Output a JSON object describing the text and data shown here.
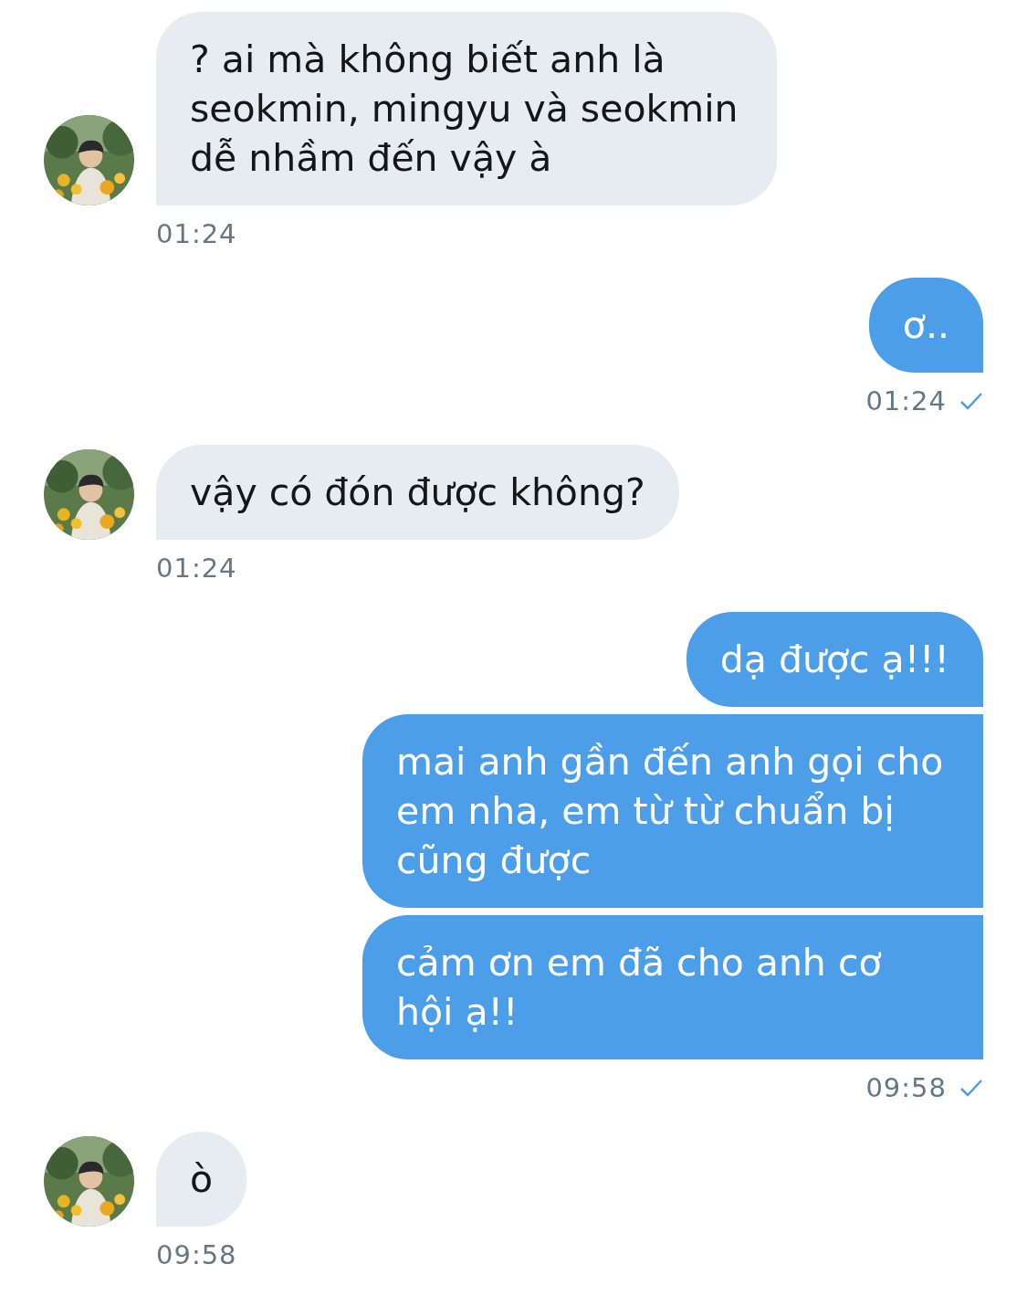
{
  "messages": [
    {
      "kind": "incoming",
      "bubbles": [
        "? ai mà không biết anh là seokmin, mingyu và seokmin dễ nhầm đến vậy à"
      ],
      "time": "01:24"
    },
    {
      "kind": "outgoing",
      "bubbles": [
        "ơ.."
      ],
      "time": "01:24",
      "delivered": true
    },
    {
      "kind": "incoming",
      "bubbles": [
        "vậy có đón được không?"
      ],
      "time": "01:24"
    },
    {
      "kind": "outgoing",
      "bubbles": [
        "dạ được ạ!!!",
        "mai anh gần đến anh gọi cho em nha, em từ từ chuẩn bị cũng được",
        "cảm ơn em đã cho anh cơ hội ạ!!"
      ],
      "time": "09:58",
      "delivered": true
    },
    {
      "kind": "incoming",
      "bubbles": [
        "ò"
      ],
      "time": "09:58"
    }
  ]
}
